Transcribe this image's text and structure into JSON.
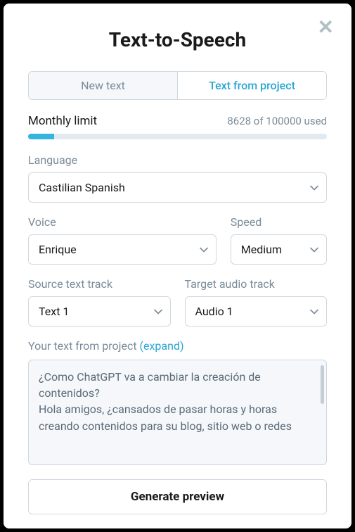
{
  "title": "Text-to-Speech",
  "tabs": {
    "new_text": "New text",
    "from_project": "Text from project"
  },
  "limit": {
    "label": "Monthly limit",
    "used": 8628,
    "total": 100000,
    "text": "8628 of 100000 used"
  },
  "fields": {
    "language": {
      "label": "Language",
      "value": "Castilian Spanish"
    },
    "voice": {
      "label": "Voice",
      "value": "Enrique"
    },
    "speed": {
      "label": "Speed",
      "value": "Medium"
    },
    "source_track": {
      "label": "Source text track",
      "value": "Text 1"
    },
    "target_track": {
      "label": "Target audio track",
      "value": "Audio 1"
    }
  },
  "textarea": {
    "label": "Your text from project ",
    "expand": "(expand)",
    "content": "¿Como ChatGPT va a cambiar la creación de contenidos?\nHola amigos, ¿cansados de pasar horas y horas creando contenidos para su blog, sitio web o redes"
  },
  "buttons": {
    "generate": "Generate preview"
  }
}
